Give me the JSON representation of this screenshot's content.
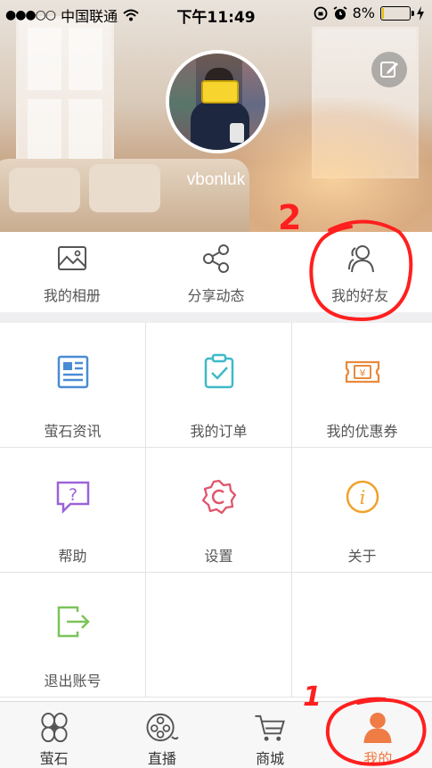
{
  "status_bar": {
    "carrier": "中国联通",
    "time": "下午11:49",
    "battery_percent": "8%",
    "battery_level": 0.08
  },
  "profile": {
    "username": "vbonluk"
  },
  "quick_actions": [
    {
      "label": "我的相册",
      "icon": "photo-album-icon"
    },
    {
      "label": "分享动态",
      "icon": "share-icon"
    },
    {
      "label": "我的好友",
      "icon": "friends-icon"
    }
  ],
  "menu_grid": [
    {
      "label": "萤石资讯",
      "icon": "news-icon",
      "color": "#4a8bd6"
    },
    {
      "label": "我的订单",
      "icon": "order-icon",
      "color": "#3fb9c8"
    },
    {
      "label": "我的优惠券",
      "icon": "coupon-icon",
      "color": "#e98a3d"
    },
    {
      "label": "帮助",
      "icon": "help-icon",
      "color": "#9a63d8"
    },
    {
      "label": "设置",
      "icon": "settings-icon",
      "color": "#e0566c"
    },
    {
      "label": "关于",
      "icon": "about-icon",
      "color": "#f0a12a"
    },
    {
      "label": "退出账号",
      "icon": "logout-icon",
      "color": "#7cc45a"
    }
  ],
  "tab_bar": [
    {
      "label": "萤石",
      "icon": "home-icon"
    },
    {
      "label": "直播",
      "icon": "live-icon"
    },
    {
      "label": "商城",
      "icon": "cart-icon"
    },
    {
      "label": "我的",
      "icon": "me-icon",
      "active": true
    }
  ],
  "annotations": {
    "mark_friends": "2",
    "mark_me": "1",
    "color": "#ff1f1f"
  },
  "accent_color": "#ef7b45"
}
